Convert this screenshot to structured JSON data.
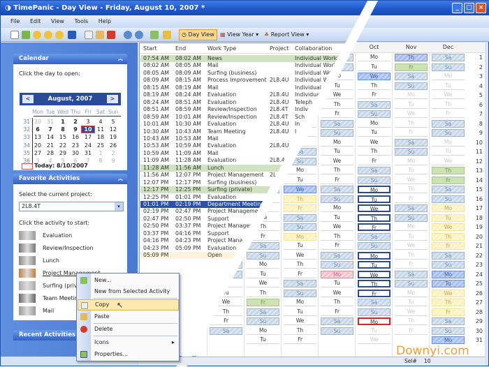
{
  "window": {
    "title": "TimePanic - Day View - Friday, August 10, 2007 *"
  },
  "menu": [
    "File",
    "Edit",
    "View",
    "Tools",
    "Help"
  ],
  "toolbar": {
    "day_view": "Day View",
    "view_year": "View Year",
    "report_view": "Report View"
  },
  "calendar": {
    "title": "Calendar",
    "prompt": "Click the day to open:",
    "month_label": "August, 2007",
    "prev": "<",
    "next": ">",
    "day_names": [
      "Mon",
      "Tue",
      "Wed",
      "Thu",
      "Fri",
      "Sat",
      "Sun"
    ],
    "weeks": [
      {
        "num": "31",
        "days": [
          "30",
          "31",
          "1",
          "2",
          "3",
          "4",
          "5"
        ]
      },
      {
        "num": "32",
        "days": [
          "6",
          "7",
          "8",
          "9",
          "10",
          "11",
          "12"
        ]
      },
      {
        "num": "33",
        "days": [
          "13",
          "14",
          "15",
          "16",
          "17",
          "18",
          "19"
        ]
      },
      {
        "num": "34",
        "days": [
          "20",
          "21",
          "22",
          "23",
          "24",
          "25",
          "26"
        ]
      },
      {
        "num": "35",
        "days": [
          "27",
          "28",
          "29",
          "30",
          "31",
          "1",
          "2"
        ]
      },
      {
        "num": "36",
        "days": [
          "3",
          "4",
          "5",
          "6",
          "7",
          "8",
          "9"
        ]
      }
    ],
    "selected_day": "10",
    "today_label": "Today: 8/10/2007"
  },
  "favorites": {
    "title": "Favorite Activities",
    "project_prompt": "Select the current project:",
    "project_value": "2L8.4T",
    "activity_prompt": "Click the activity to start:",
    "activities": [
      "Evaluation",
      "Review/Inspection",
      "Lunch",
      "Project Management",
      "Surfing (private)",
      "Team Meeting",
      "Mail"
    ]
  },
  "recent": {
    "title": "Recent Activities"
  },
  "day_table": {
    "headers": [
      "Start",
      "End",
      "Work Type",
      "Project",
      "Collaboration"
    ],
    "rows": [
      {
        "start": "07:54 AM",
        "end": "08:02 AM",
        "type": "News",
        "project": "",
        "collab": "Individual Work",
        "style": "green"
      },
      {
        "start": "08:02 AM",
        "end": "08:05 AM",
        "type": "Mail",
        "project": "",
        "collab": "Individual Work",
        "style": ""
      },
      {
        "start": "08:05 AM",
        "end": "08:09 AM",
        "type": "Surfing (business)",
        "project": "",
        "collab": "Individual Work",
        "style": ""
      },
      {
        "start": "08:09 AM",
        "end": "08:15 AM",
        "type": "Process Improvement",
        "project": "2L8.4U",
        "collab": "Individual Work",
        "style": ""
      },
      {
        "start": "08:15 AM",
        "end": "08:19 AM",
        "type": "Mail",
        "project": "",
        "collab": "Individual Work",
        "style": ""
      },
      {
        "start": "08:19 AM",
        "end": "08:24 AM",
        "type": "Evaluation",
        "project": "2L8.4U",
        "collab": "Individual Work",
        "style": ""
      },
      {
        "start": "08:24 AM",
        "end": "08:51 AM",
        "type": "Evaluation",
        "project": "2L8.4U",
        "collab": "Teleph",
        "style": ""
      },
      {
        "start": "08:51 AM",
        "end": "08:59 AM",
        "type": "Review/Inspection",
        "project": "2L8.4T",
        "collab": "Indiv",
        "style": ""
      },
      {
        "start": "08:59 AM",
        "end": "10:01 AM",
        "type": "Review/Inspection",
        "project": "2L8.4T",
        "collab": "Sch",
        "style": ""
      },
      {
        "start": "10:01 AM",
        "end": "10:30 AM",
        "type": "Evaluation",
        "project": "2L8.4U",
        "collab": "In",
        "style": ""
      },
      {
        "start": "10:30 AM",
        "end": "10:43 AM",
        "type": "Team Meeting",
        "project": "2L8.4U",
        "collab": "I",
        "style": ""
      },
      {
        "start": "10:43 AM",
        "end": "10:53 AM",
        "type": "Mail",
        "project": "",
        "collab": "",
        "style": ""
      },
      {
        "start": "10:53 AM",
        "end": "10:59 AM",
        "type": "Evaluation",
        "project": "2L8.4U",
        "collab": "",
        "style": ""
      },
      {
        "start": "10:59 AM",
        "end": "11:09 AM",
        "type": "Mail",
        "project": "",
        "collab": "",
        "style": ""
      },
      {
        "start": "11:09 AM",
        "end": "11:28 AM",
        "type": "Evaluation",
        "project": "2L8.4U",
        "collab": "",
        "style": ""
      },
      {
        "start": "11:28 AM",
        "end": "11:56 AM",
        "type": "Lunch",
        "project": "",
        "collab": "",
        "style": "green"
      },
      {
        "start": "11:56 AM",
        "end": "12:07 PM",
        "type": "Project Management",
        "project": "2L",
        "collab": "",
        "style": ""
      },
      {
        "start": "12:07 PM",
        "end": "12:17 PM",
        "type": "Surfing (business)",
        "project": "",
        "collab": "",
        "style": ""
      },
      {
        "start": "12:17 PM",
        "end": "12:25 PM",
        "type": "Surfing (private)",
        "project": "",
        "collab": "",
        "style": "green"
      },
      {
        "start": "12:25 PM",
        "end": "01:01 PM",
        "type": "Evaluation",
        "project": "",
        "collab": "",
        "style": ""
      },
      {
        "start": "01:01 PM",
        "end": "02:19 PM",
        "type": "Department Meeting",
        "project": "",
        "collab": "",
        "style": "selected"
      },
      {
        "start": "02:19 PM",
        "end": "02:47 PM",
        "type": "Project Management",
        "project": "",
        "collab": "",
        "style": ""
      },
      {
        "start": "02:47 PM",
        "end": "02:50 PM",
        "type": "Support",
        "project": "",
        "collab": "",
        "style": ""
      },
      {
        "start": "02:50 PM",
        "end": "03:37 PM",
        "type": "Project Management",
        "project": "",
        "collab": "",
        "style": ""
      },
      {
        "start": "03:37 PM",
        "end": "04:16 PM",
        "type": "Support",
        "project": "",
        "collab": "",
        "style": ""
      },
      {
        "start": "04:16 PM",
        "end": "04:23 PM",
        "type": "Project Management",
        "project": "",
        "collab": "",
        "style": ""
      },
      {
        "start": "04:23 PM",
        "end": "05:09 PM",
        "type": "Evaluation",
        "project": "",
        "collab": "",
        "style": ""
      },
      {
        "start": "05:09 PM",
        "end": "",
        "type": "Open",
        "project": "",
        "collab": "",
        "style": "open"
      }
    ]
  },
  "year_view": {
    "year": 2007,
    "weekday_abbr": [
      "Su",
      "Mo",
      "Tu",
      "We",
      "Th",
      "Fr",
      "Sa"
    ],
    "months": [
      {
        "label": "",
        "month": 6,
        "overrides": {},
        "grey_from": 0
      },
      {
        "label": "",
        "month": 7,
        "overrides": {
          "27": "g"
        },
        "grey_from": 0
      },
      {
        "label": "",
        "month": 8,
        "overrides": {
          "15": "b",
          "16": "y",
          "17": "y",
          "20": "y"
        },
        "grey_from": 0
      },
      {
        "label": "",
        "month": 9,
        "overrides": {
          "24": "r"
        },
        "grey_from": 0
      },
      {
        "label": "Oct",
        "month": 10,
        "overrides": {
          "3": "b",
          "15": "o",
          "16": "o",
          "17": "o",
          "18": "o",
          "19": "o",
          "22": "o",
          "23": "o",
          "24": "o",
          "25": "o",
          "26": "o",
          "29": "t",
          "30": "x",
          "31": "x"
        },
        "grey_from": 0
      },
      {
        "label": "Nov",
        "month": 11,
        "overrides": {
          "1": "b",
          "2": "g"
        },
        "grey_from": 5
      },
      {
        "label": "Dec",
        "month": 12,
        "overrides": {
          "13": "g",
          "14": "g",
          "17": "y",
          "18": "y",
          "19": "y",
          "20": "y",
          "21": "y",
          "24": "b",
          "25": "b",
          "26": "y",
          "27": "y",
          "28": "y",
          "31": "b"
        },
        "grey_from": 1
      }
    ]
  },
  "context_menu": {
    "items": [
      "New...",
      "New from Selected Activity",
      "Copy",
      "Paste",
      "Delete",
      "Icons",
      "Properties..."
    ],
    "highlighted": "Copy"
  },
  "status": {
    "sel_label": "Sel#",
    "sel_value": "10"
  },
  "watermark": "Downyi.com",
  "colors": {
    "title": "#1f56c8",
    "selected_row": "#2a4fa8",
    "green_row": "#cfe3c0",
    "open_row": "#fdf3dc"
  }
}
